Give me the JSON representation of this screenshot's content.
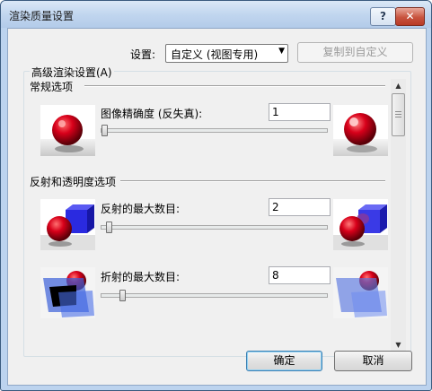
{
  "window": {
    "title": "渲染质量设置",
    "help_label": "?",
    "close_label": "✕"
  },
  "settings": {
    "label": "设置:",
    "combo_value": "自定义 (视图专用)",
    "copy_button": "复制到自定义"
  },
  "advanced": {
    "caption": "高级渲染设置(A)",
    "groups": [
      {
        "title": "常规选项",
        "items": [
          {
            "label": "图像精确度 (反失真):",
            "value": "1",
            "slider_fraction": 0.0
          }
        ]
      },
      {
        "title": "反射和透明度选项",
        "items": [
          {
            "label": "反射的最大数目:",
            "value": "2",
            "slider_fraction": 0.02
          },
          {
            "label": "折射的最大数目:",
            "value": "8",
            "slider_fraction": 0.08
          }
        ]
      }
    ]
  },
  "buttons": {
    "ok": "确定",
    "cancel": "取消"
  },
  "colors": {
    "title_gradient_top": "#dbe8f7",
    "face": "#f0f0f0",
    "close_red": "#c8533e",
    "sphere_red": "#d8001a",
    "cube_blue": "#2a2ae0"
  }
}
